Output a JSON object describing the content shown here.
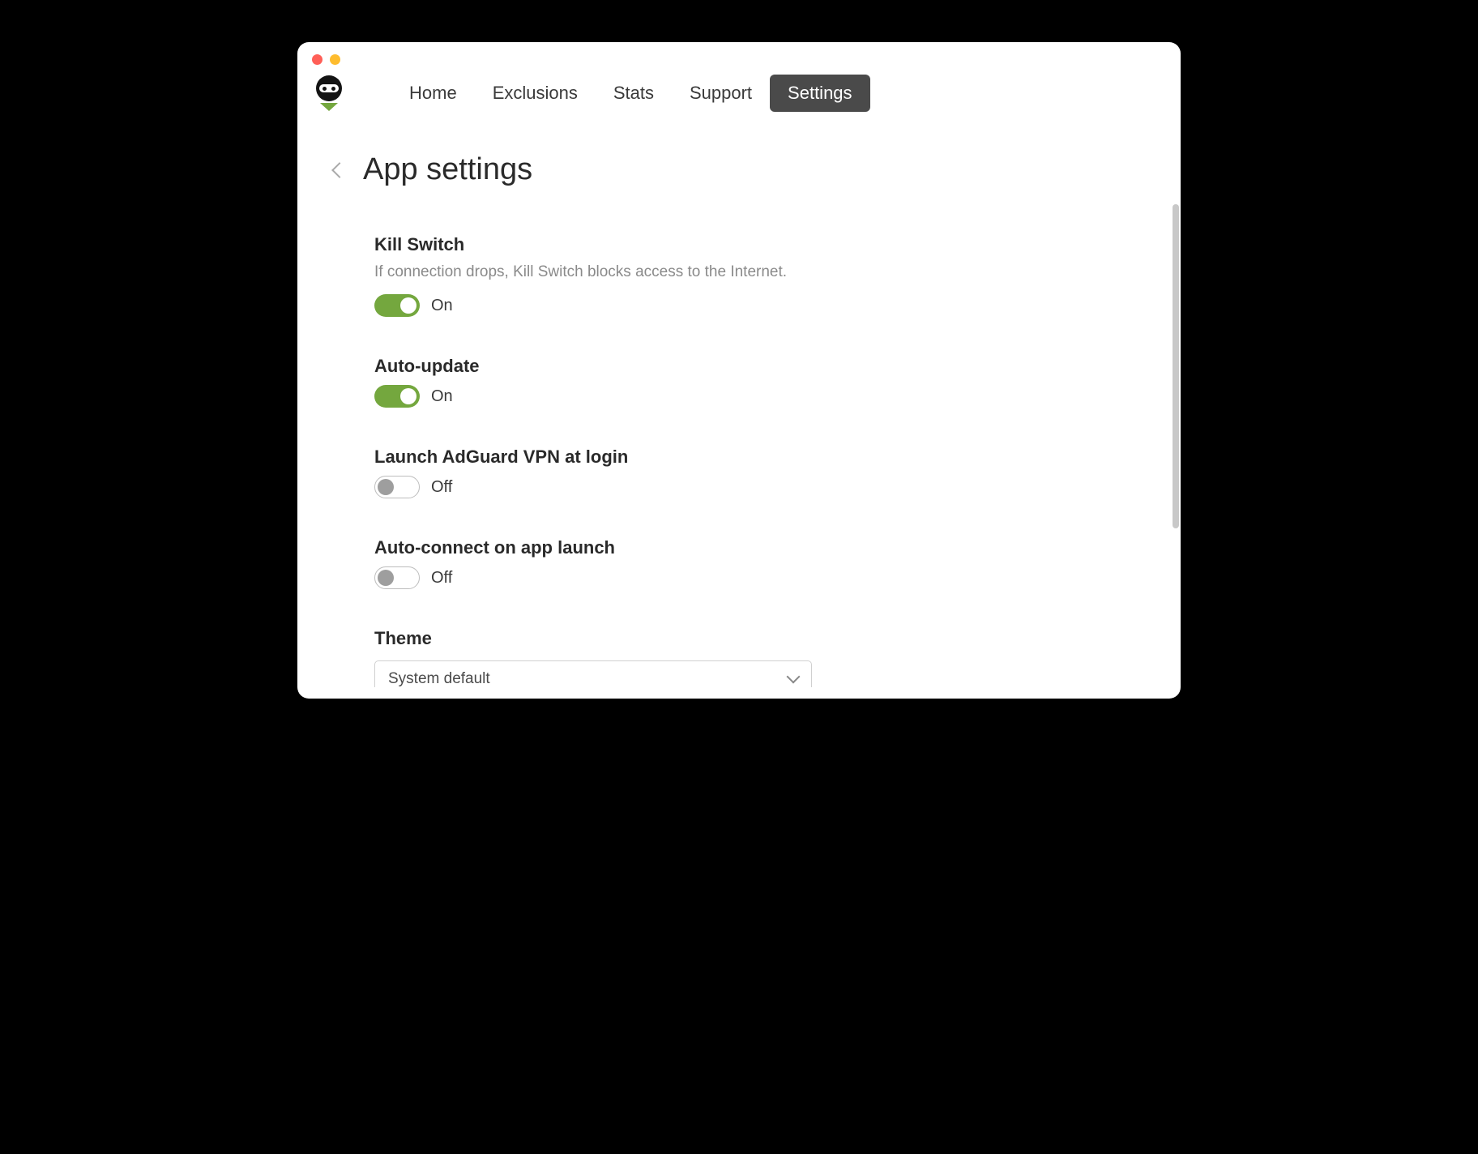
{
  "nav": {
    "items": [
      {
        "label": "Home",
        "active": false
      },
      {
        "label": "Exclusions",
        "active": false
      },
      {
        "label": "Stats",
        "active": false
      },
      {
        "label": "Support",
        "active": false
      },
      {
        "label": "Settings",
        "active": true
      }
    ]
  },
  "page": {
    "title": "App settings"
  },
  "settings": {
    "kill_switch": {
      "title": "Kill Switch",
      "description": "If connection drops, Kill Switch blocks access to the Internet.",
      "state_label": "On",
      "on": true
    },
    "auto_update": {
      "title": "Auto-update",
      "state_label": "On",
      "on": true
    },
    "launch_at_login": {
      "title": "Launch AdGuard VPN at login",
      "state_label": "Off",
      "on": false
    },
    "auto_connect": {
      "title": "Auto-connect on app launch",
      "state_label": "Off",
      "on": false
    },
    "theme": {
      "title": "Theme",
      "selected": "System default"
    }
  },
  "colors": {
    "accent": "#74a73e",
    "nav_active_bg": "#4a4a4a"
  }
}
